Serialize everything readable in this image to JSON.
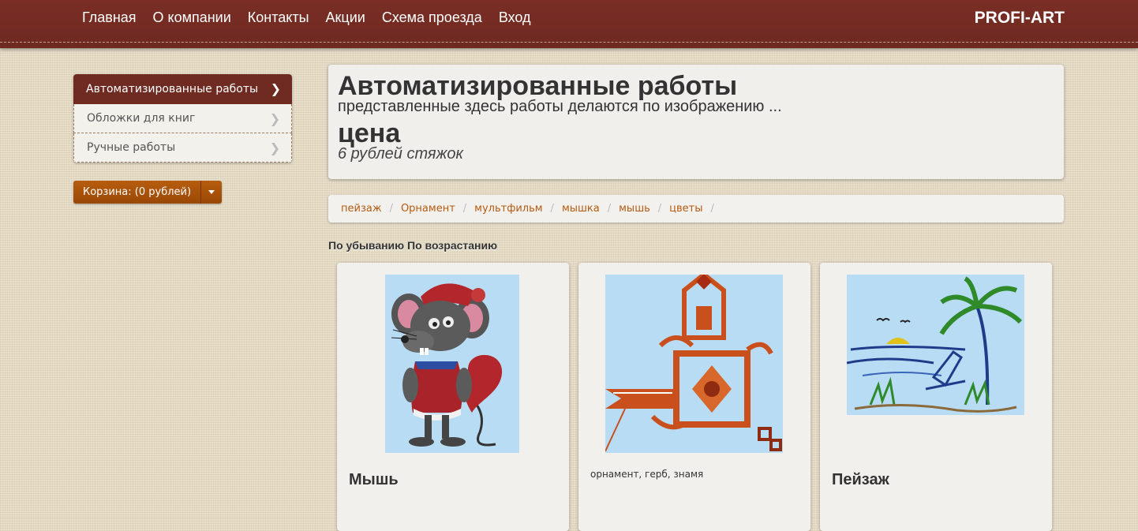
{
  "nav": {
    "links": [
      "Главная",
      "О компании",
      "Контакты",
      "Акции",
      "Схема проезда",
      "Вход"
    ],
    "brand": "PROFI-ART"
  },
  "sidebar": {
    "items": [
      {
        "label": "Автоматизированные работы",
        "active": true
      },
      {
        "label": "Обложки для книг",
        "active": false
      },
      {
        "label": "Ручные работы",
        "active": false
      }
    ],
    "cart_label": "Корзина: (0 рублей)"
  },
  "hero": {
    "title": "Автоматизированные работы",
    "subtitle": "представленные здесь работы делаются по изображению ...",
    "price_label": "цена",
    "price": "6 рублей стяжок"
  },
  "tags": [
    "пейзаж",
    "Орнамент",
    "мультфильм",
    "мышка",
    "мышь",
    "цветы"
  ],
  "tag_separator": "/",
  "sort": {
    "desc_label": "По убыванию",
    "asc_label": "По возрастанию"
  },
  "cards": [
    {
      "title": "Мышь",
      "description": "",
      "image_icon": "embroidered-mouse-image"
    },
    {
      "title": "",
      "description": "орнамент, герб, знамя",
      "image_icon": "embroidered-ornament-image"
    },
    {
      "title": "Пейзаж",
      "description": "",
      "image_icon": "embroidered-landscape-image"
    }
  ],
  "colors": {
    "navbar": "#722b22",
    "accent_orange": "#b55a0f",
    "image_background": "#b9dcf5"
  }
}
